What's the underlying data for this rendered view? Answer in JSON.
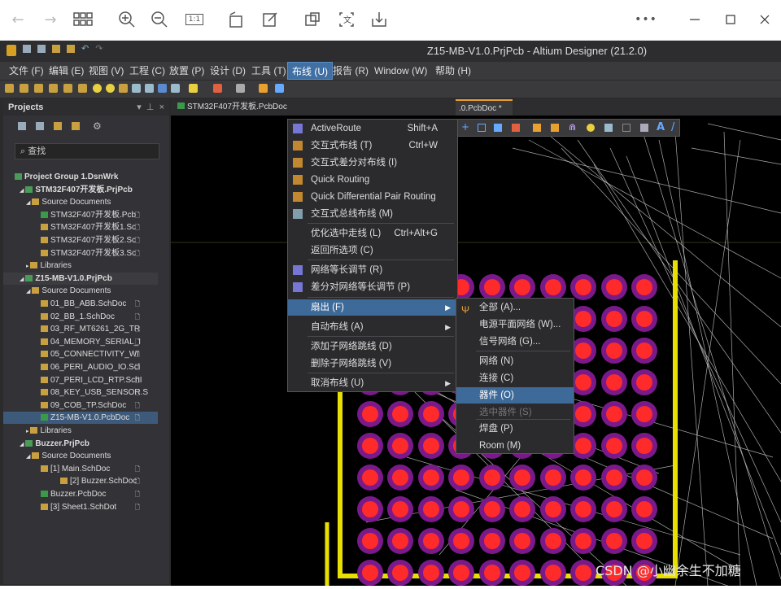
{
  "viewer": {
    "icons": [
      "back-arrow-icon",
      "forward-arrow-icon",
      "grid-view-icon",
      "zoom-in-icon",
      "zoom-out-icon",
      "actual-size-icon",
      "rotate-icon",
      "edit-icon",
      "crop-icon",
      "text-icon",
      "save-icon",
      "more-icon",
      "minimize-icon",
      "maximize-icon",
      "close-icon"
    ],
    "actual_size_label": "1:1",
    "more_label": "•••"
  },
  "app": {
    "title": "Z15-MB-V1.0.PrjPcb - Altium Designer (21.2.0)"
  },
  "menubar": [
    {
      "label": "文件 (F)"
    },
    {
      "label": "编辑 (E)"
    },
    {
      "label": "视图 (V)"
    },
    {
      "label": "工程 (C)"
    },
    {
      "label": "放置 (P)"
    },
    {
      "label": "设计 (D)"
    },
    {
      "label": "工具 (T)"
    },
    {
      "label": "布线 (U)"
    },
    {
      "label": "报告 (R)"
    },
    {
      "label": "Window (W)"
    },
    {
      "label": "帮助 (H)"
    }
  ],
  "projects": {
    "title": "Projects",
    "search_placeholder": "查找",
    "tree": [
      {
        "label": "Project Group 1.DsnWrk",
        "level": 0,
        "bold": true
      },
      {
        "label": "STM32F407开发板.PrjPcb",
        "level": 1,
        "bold": true
      },
      {
        "label": "Source Documents",
        "level": 2
      },
      {
        "label": "STM32F407开发板.Pcb",
        "level": 3
      },
      {
        "label": "STM32F407开发板1.Sc",
        "level": 3
      },
      {
        "label": "STM32F407开发板2.Sc",
        "level": 3
      },
      {
        "label": "STM32F407开发板3.Sc",
        "level": 3
      },
      {
        "label": "Libraries",
        "level": 2
      },
      {
        "label": "Z15-MB-V1.0.PrjPcb",
        "level": 1,
        "bold": true
      },
      {
        "label": "Source Documents",
        "level": 2
      },
      {
        "label": "01_BB_ABB.SchDoc",
        "level": 3
      },
      {
        "label": "02_BB_1.SchDoc",
        "level": 3
      },
      {
        "label": "03_RF_MT6261_2G_TR",
        "level": 3
      },
      {
        "label": "04_MEMORY_SERIAL_I",
        "level": 3
      },
      {
        "label": "05_CONNECTIVITY_WI",
        "level": 3
      },
      {
        "label": "06_PERI_AUDIO_IO.Scl",
        "level": 3
      },
      {
        "label": "07_PERI_LCD_RTP.SchI",
        "level": 3
      },
      {
        "label": "08_KEY_USB_SENSOR.S",
        "level": 3
      },
      {
        "label": "09_COB_TP.SchDoc",
        "level": 3
      },
      {
        "label": "Z15-MB-V1.0.PcbDoc",
        "level": 3
      },
      {
        "label": "Libraries",
        "level": 2
      },
      {
        "label": "Buzzer.PrjPcb",
        "level": 1,
        "bold": true
      },
      {
        "label": "Source Documents",
        "level": 2
      },
      {
        "label": "[1] Main.SchDoc",
        "level": 3
      },
      {
        "label": "[2] Buzzer.SchDoc",
        "level": 4
      },
      {
        "label": "Buzzer.PcbDoc",
        "level": 3
      },
      {
        "label": "[3] Sheet1.SchDot",
        "level": 3
      }
    ]
  },
  "tabs": [
    {
      "label": "STM32F407开发板.PcbDoc"
    },
    {
      "label": ".0.PcbDoc *"
    }
  ],
  "route_menu": {
    "items": [
      {
        "label": "ActiveRoute",
        "shortcut": "Shift+A",
        "icon": "active-route-icon"
      },
      {
        "label": "交互式布线 (T)",
        "shortcut": "Ctrl+W",
        "icon": "interactive-route-icon"
      },
      {
        "label": "交互式差分对布线 (I)",
        "shortcut": "",
        "icon": "diff-pair-route-icon"
      },
      {
        "label": "Quick Routing",
        "shortcut": "",
        "icon": "quick-routing-icon"
      },
      {
        "label": "Quick Differential Pair Routing",
        "shortcut": "",
        "icon": "quick-diff-pair-icon"
      },
      {
        "label": "交互式总线布线 (M)",
        "shortcut": "",
        "icon": "bus-route-icon"
      },
      {
        "label": "优化选中走线 (L)",
        "shortcut": "Ctrl+Alt+G",
        "icon": ""
      },
      {
        "label": "返回所选项 (C)",
        "shortcut": "",
        "icon": ""
      },
      {
        "label": "网络等长调节 (R)",
        "shortcut": "",
        "icon": "length-tune-icon"
      },
      {
        "label": "差分对网络等长调节 (P)",
        "shortcut": "",
        "icon": "diff-length-tune-icon"
      },
      {
        "label": "扇出 (F)",
        "shortcut": "",
        "icon": "",
        "submenu": true
      },
      {
        "label": "自动布线 (A)",
        "shortcut": "",
        "icon": "",
        "submenu": true
      },
      {
        "label": "添加子网络跳线 (D)",
        "shortcut": "",
        "icon": ""
      },
      {
        "label": "删除子网络跳线 (V)",
        "shortcut": "",
        "icon": ""
      },
      {
        "label": "取消布线 (U)",
        "shortcut": "",
        "icon": "",
        "submenu": true
      }
    ]
  },
  "fanout_menu": {
    "items": [
      {
        "label": "全部 (A)...",
        "icon": "fanout-icon"
      },
      {
        "label": "电源平面网络 (W)...",
        "icon": ""
      },
      {
        "label": "信号网络 (G)...",
        "icon": ""
      },
      {
        "label": "网络 (N)",
        "icon": ""
      },
      {
        "label": "连接 (C)",
        "icon": ""
      },
      {
        "label": "器件 (O)",
        "icon": "",
        "highlighted": true
      },
      {
        "label": "选中器件 (S)",
        "icon": "",
        "disabled": true
      },
      {
        "label": "焊盘 (P)",
        "icon": ""
      },
      {
        "label": "Room (M)",
        "icon": ""
      }
    ]
  },
  "colors": {
    "menu_highlight": "#3d6a99",
    "pad_outer": "#7a1a8a",
    "pad_inner": "#ff2a2a",
    "board_outline": "#e8e000",
    "ratsnest": "#c8c8c8"
  },
  "watermark": "CSDN @小幽余生不加糖"
}
